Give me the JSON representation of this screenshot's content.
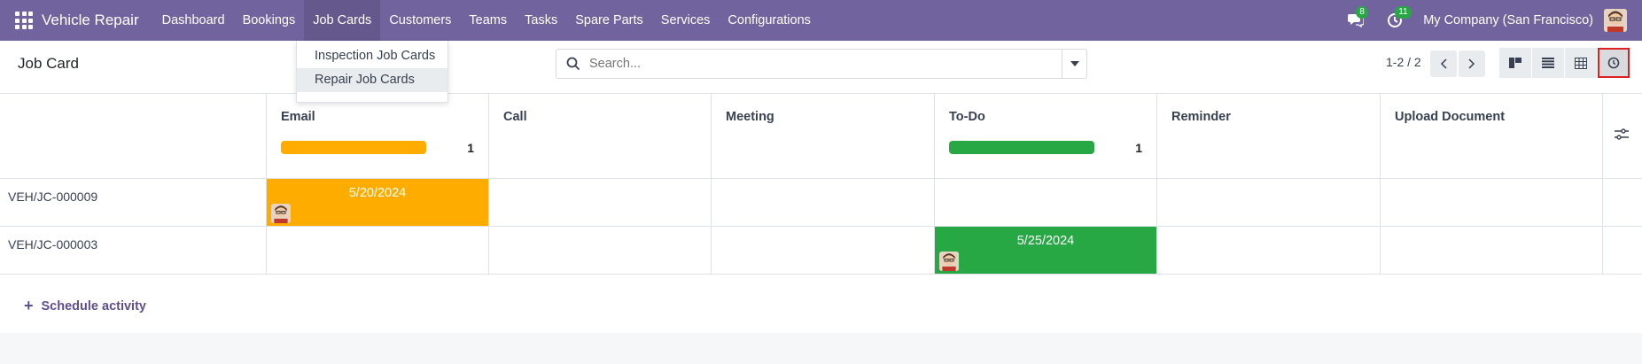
{
  "navbar": {
    "app_name": "Vehicle Repair",
    "menu": [
      "Dashboard",
      "Bookings",
      "Job Cards",
      "Customers",
      "Teams",
      "Tasks",
      "Spare Parts",
      "Services",
      "Configurations"
    ],
    "messages_count": "8",
    "activities_count": "11",
    "company": "My Company (San Francisco)"
  },
  "dropdown": {
    "items": [
      "Inspection Job Cards",
      "Repair Job Cards"
    ]
  },
  "control": {
    "title": "Job Card",
    "search_placeholder": "Search...",
    "pager": "1-2 / 2"
  },
  "columns": [
    {
      "title": "Email",
      "count": "1",
      "bar_fill": 1.0,
      "color": "#ffac00"
    },
    {
      "title": "Call",
      "count": "",
      "bar_fill": 0,
      "color": ""
    },
    {
      "title": "Meeting",
      "count": "",
      "bar_fill": 0,
      "color": ""
    },
    {
      "title": "To-Do",
      "count": "1",
      "bar_fill": 1.0,
      "color": "#28a745"
    },
    {
      "title": "Reminder",
      "count": "",
      "bar_fill": 0,
      "color": ""
    },
    {
      "title": "Upload Document",
      "count": "",
      "bar_fill": 0,
      "color": ""
    }
  ],
  "records": [
    {
      "name": "VEH/JC-000009",
      "activity_date": "5/20/2024",
      "activity_color": "#ffac00"
    },
    {
      "name": "VEH/JC-000003",
      "activity_date": "5/25/2024",
      "activity_color": "#28a745"
    }
  ],
  "footer": {
    "schedule_label": "Schedule activity"
  }
}
